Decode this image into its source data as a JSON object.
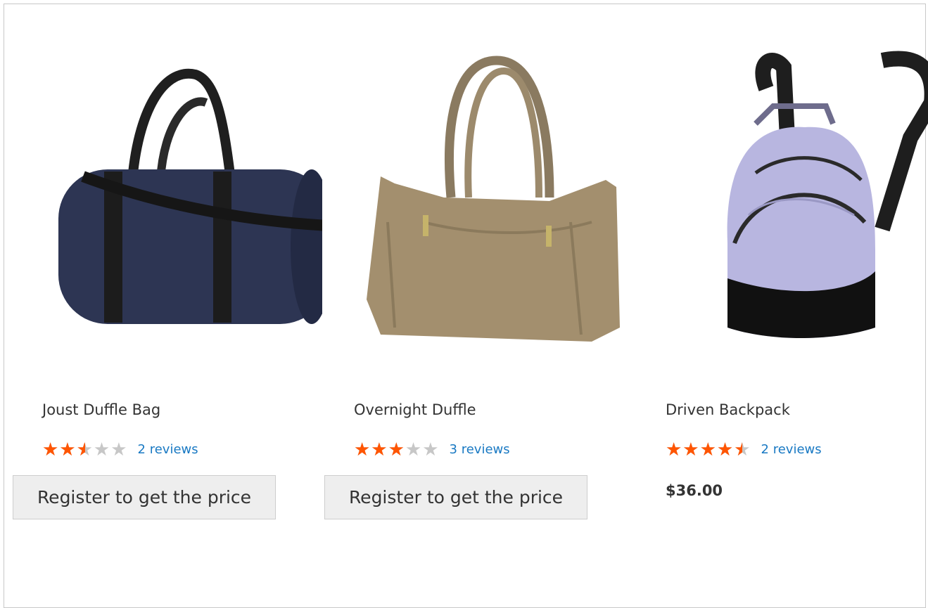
{
  "products": [
    {
      "name": "Joust Duffle Bag",
      "rating_percent": 50,
      "stars": "★★★★★",
      "reviews": "2 reviews",
      "action": "Register to get the price",
      "photo_icon": "duffle-bag-navy",
      "color": "#2d3553"
    },
    {
      "name": "Overnight Duffle",
      "rating_percent": 60,
      "stars": "★★★★★",
      "reviews": "3 reviews",
      "action": "Register to get the price",
      "photo_icon": "duffle-bag-khaki",
      "color": "#a38f6e"
    },
    {
      "name": "Driven Backpack",
      "rating_percent": 90,
      "stars": "★★★★★",
      "reviews": "2 reviews",
      "price": "$36.00",
      "photo_icon": "backpack-lavender",
      "color": "#b8b6e0"
    }
  ],
  "colors": {
    "star_active": "#ff5501",
    "star_inactive": "#c7c7c7",
    "link": "#1979c3",
    "button_bg": "#eeeeee"
  }
}
